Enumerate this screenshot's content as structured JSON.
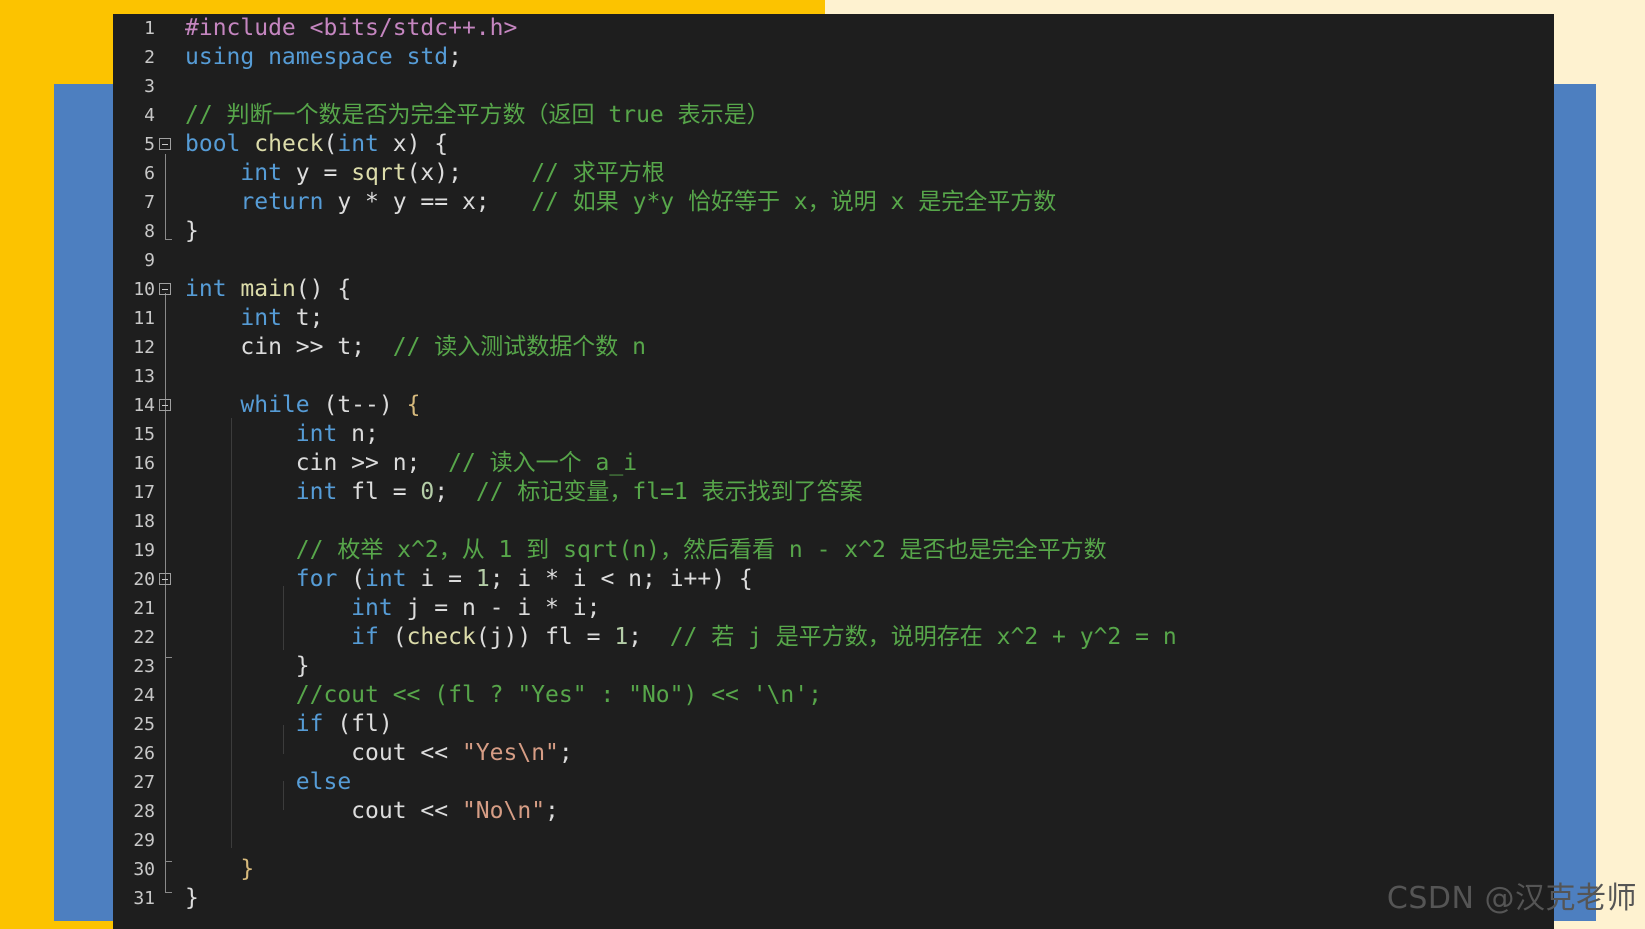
{
  "editor": {
    "lines": [
      {
        "n": "1",
        "fold": false,
        "html": "<span class=\"pp\">#include &lt;bits/stdc++.h&gt;</span>"
      },
      {
        "n": "2",
        "fold": false,
        "html": "<span class=\"kw\">using namespace</span> <span class=\"kw\">std</span>;"
      },
      {
        "n": "3",
        "fold": false,
        "html": ""
      },
      {
        "n": "4",
        "fold": false,
        "html": "<span class=\"cm\">// 判断一个数是否为完全平方数（返回 true 表示是）</span>"
      },
      {
        "n": "5",
        "fold": true,
        "html": "<span class=\"kw\">bool</span> <span class=\"fn\">check</span>(<span class=\"kw\">int</span> x) {"
      },
      {
        "n": "6",
        "fold": false,
        "html": "    <span class=\"kw\">int</span> y = <span class=\"fn\">sqrt</span>(x);     <span class=\"cm\">// 求平方根</span>"
      },
      {
        "n": "7",
        "fold": false,
        "html": "    <span class=\"kw\">return</span> y * y == x;   <span class=\"cm\">// 如果 y*y 恰好等于 x，说明 x 是完全平方数</span>"
      },
      {
        "n": "8",
        "fold": false,
        "html": "}"
      },
      {
        "n": "9",
        "fold": false,
        "html": ""
      },
      {
        "n": "10",
        "fold": true,
        "html": "<span class=\"kw\">int</span> <span class=\"fn\">main</span>() {"
      },
      {
        "n": "11",
        "fold": false,
        "html": "    <span class=\"kw\">int</span> t;"
      },
      {
        "n": "12",
        "fold": false,
        "html": "    cin &gt;&gt; t;  <span class=\"cm\">// 读入测试数据个数 n</span>"
      },
      {
        "n": "13",
        "fold": false,
        "html": ""
      },
      {
        "n": "14",
        "fold": true,
        "html": "    <span class=\"kw\">while</span> (t--) <span class=\"br\">{</span>"
      },
      {
        "n": "15",
        "fold": false,
        "html": "        <span class=\"kw\">int</span> n;"
      },
      {
        "n": "16",
        "fold": false,
        "html": "        cin &gt;&gt; n;  <span class=\"cm\">// 读入一个 a_i</span>"
      },
      {
        "n": "17",
        "fold": false,
        "html": "        <span class=\"kw\">int</span> fl = <span class=\"num\">0</span>;  <span class=\"cm\">// 标记变量，fl=1 表示找到了答案</span>"
      },
      {
        "n": "18",
        "fold": false,
        "html": ""
      },
      {
        "n": "19",
        "fold": false,
        "html": "        <span class=\"cm\">// 枚举 x^2，从 1 到 sqrt(n)，然后看看 n - x^2 是否也是完全平方数</span>"
      },
      {
        "n": "20",
        "fold": true,
        "html": "        <span class=\"kw\">for</span> (<span class=\"kw\">int</span> i = <span class=\"num\">1</span>; i * i &lt; n; i++) {"
      },
      {
        "n": "21",
        "fold": false,
        "html": "            <span class=\"kw\">int</span> j = n - i * i;"
      },
      {
        "n": "22",
        "fold": false,
        "html": "            <span class=\"kw\">if</span> (<span class=\"fn\">check</span>(j)) fl = <span class=\"num\">1</span>;  <span class=\"cm\">// 若 j 是平方数，说明存在 x^2 + y^2 = n</span>"
      },
      {
        "n": "23",
        "fold": false,
        "html": "        }"
      },
      {
        "n": "24",
        "fold": false,
        "html": "        <span class=\"cm\">//cout &lt;&lt; (fl ? \"Yes\" : \"No\") &lt;&lt; '\\n';</span>"
      },
      {
        "n": "25",
        "fold": false,
        "html": "        <span class=\"kw\">if</span> (fl)"
      },
      {
        "n": "26",
        "fold": false,
        "html": "            cout &lt;&lt; <span class=\"str\">\"Yes\\n\"</span>;"
      },
      {
        "n": "27",
        "fold": false,
        "html": "        <span class=\"kw\">else</span>"
      },
      {
        "n": "28",
        "fold": false,
        "html": "            cout &lt;&lt; <span class=\"str\">\"No\\n\"</span>;"
      },
      {
        "n": "29",
        "fold": false,
        "html": ""
      },
      {
        "n": "30",
        "fold": false,
        "html": "    <span class=\"br\">}</span>"
      },
      {
        "n": "31",
        "fold": false,
        "html": "}"
      }
    ]
  },
  "watermark": "CSDN @汉克老师",
  "colors": {
    "keyword": "#569cd6",
    "preprocessor": "#c586c0",
    "comment": "#57a64a",
    "string": "#d69d85",
    "function": "#dcdcaa",
    "number": "#b5cea8",
    "background": "#1e1e1e"
  }
}
